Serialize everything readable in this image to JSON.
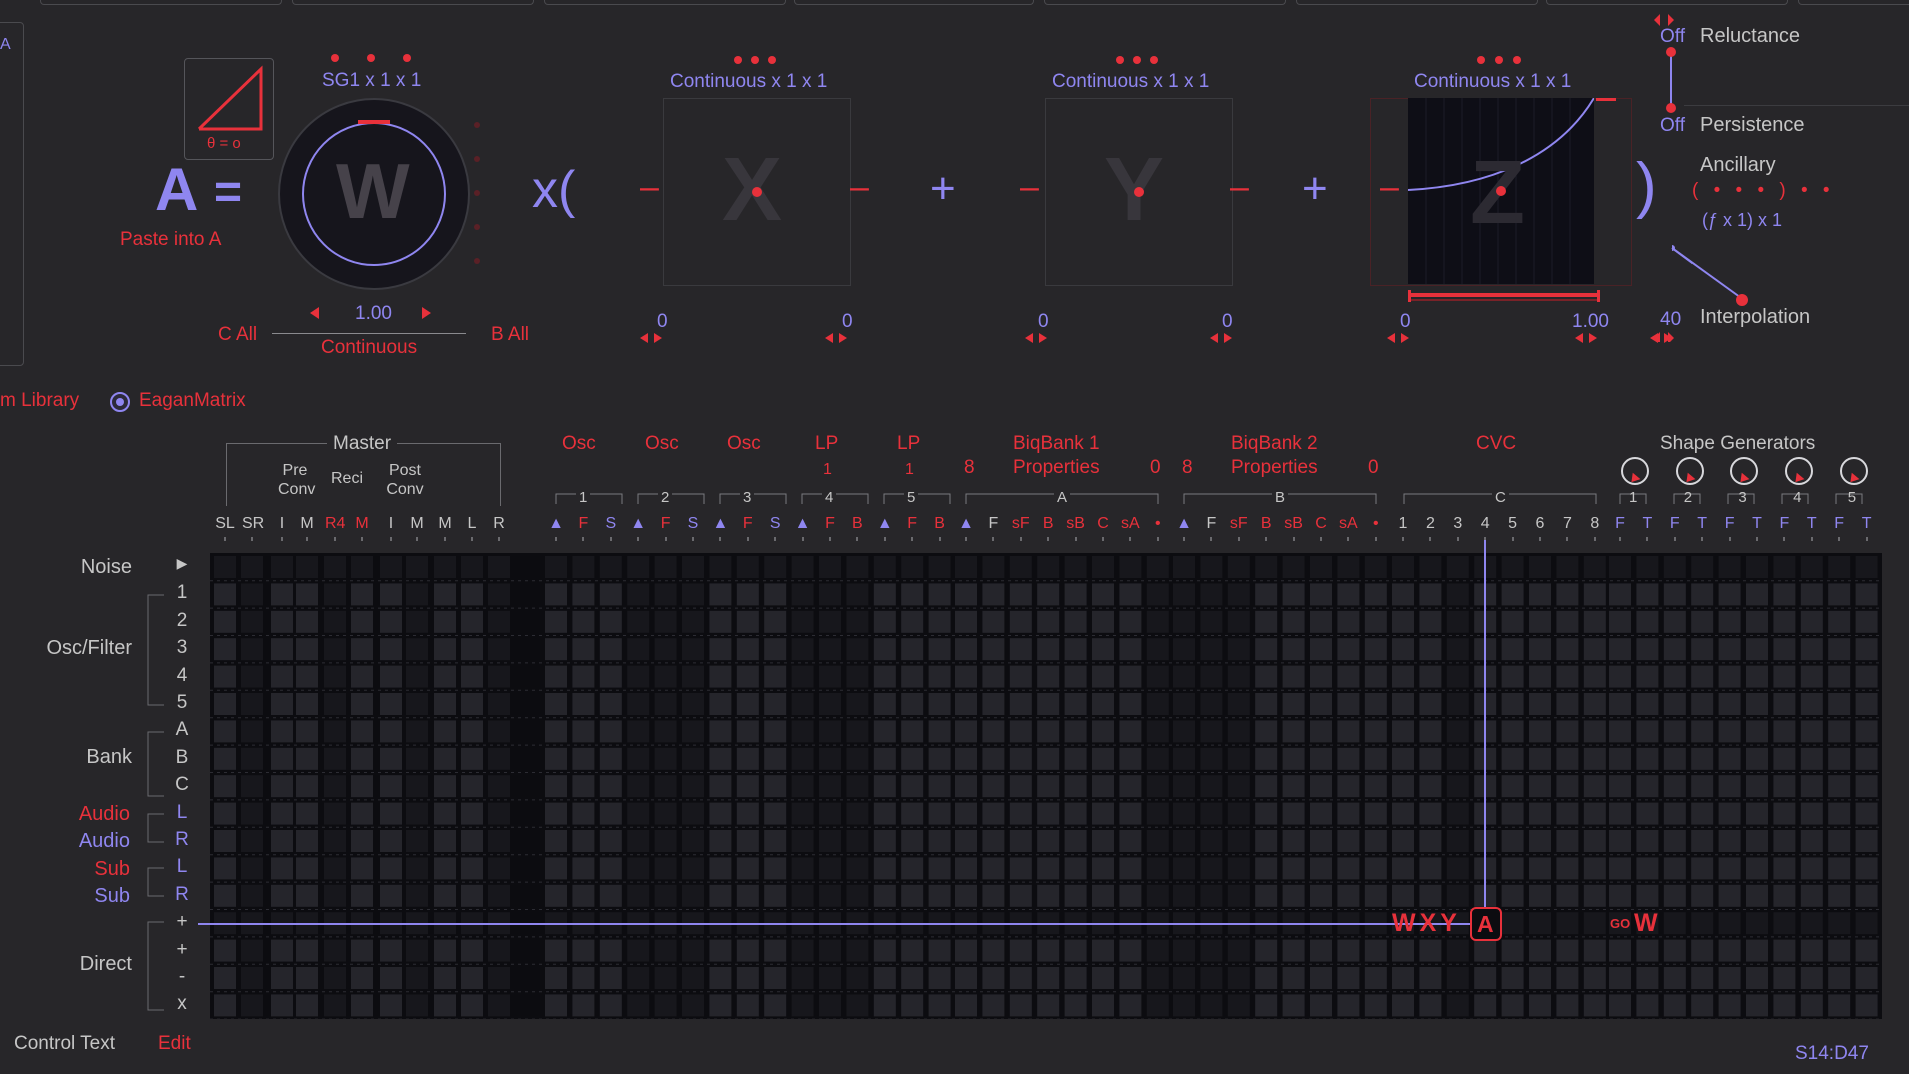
{
  "equation": {
    "lhs": "A",
    "equals": "=",
    "paste_label": "Paste into A",
    "ramp_caption": "θ = o",
    "w_header": "SG1 x 1 x 1",
    "w_letter": "W",
    "w_value": "1.00",
    "w_mode": "Continuous",
    "c_all": "C All",
    "b_all": "B All",
    "times_open": "x(",
    "close_paren": ")",
    "plus": "+",
    "minus": "–",
    "terms": [
      {
        "header": "Continuous x 1 x 1",
        "letter": "X",
        "left": "0",
        "right": "0"
      },
      {
        "header": "Continuous x 1 x 1",
        "letter": "Y",
        "left": "0",
        "right": "0"
      },
      {
        "header": "Continuous x 1 x 1",
        "letter": "Z",
        "left": "0",
        "right": "1.00"
      }
    ]
  },
  "side": {
    "reluctance_value": "Off",
    "reluctance_label": "Reluctance",
    "persistence_value": "Off",
    "persistence_label": "Persistence",
    "ancillary_label": "Ancillary",
    "ancillary_expr": "( • • • ) • •",
    "ancillary_sub": "(ƒ x 1) x 1",
    "interpolation_value": "40",
    "interpolation_label": "Interpolation"
  },
  "library": {
    "left_label": "m Library",
    "eagan_label": "EaganMatrix",
    "left_tab_letter": "A"
  },
  "matrix": {
    "master_label": "Master",
    "pre_conv": "Pre Conv",
    "reci": "Reci",
    "post_conv": "Post Conv",
    "group_labels": [
      {
        "text": "Osc",
        "sub": "1"
      },
      {
        "text": "Osc",
        "sub": "2"
      },
      {
        "text": "Osc",
        "sub": "3"
      },
      {
        "text": "LP",
        "sub": "4",
        "num": "1"
      },
      {
        "text": "LP",
        "sub": "5",
        "num": "1"
      }
    ],
    "biq1_title": "BiqBank 1",
    "biq1_props": "Properties",
    "biq1_left": "8",
    "biq1_right": "0",
    "biq1_letter": "A",
    "biq2_title": "BiqBank 2",
    "biq2_props": "Properties",
    "biq2_left": "8",
    "biq2_right": "0",
    "biq2_letter": "B",
    "cvc_title": "CVC",
    "cvc_letter": "C",
    "shape_title": "Shape Generators",
    "shape_nums": [
      "1",
      "2",
      "3",
      "4",
      "5"
    ],
    "columns_master": [
      "SL",
      "SR",
      "I",
      "M",
      "R4",
      "M",
      "I",
      "M",
      "M",
      "L",
      "R"
    ],
    "columns_osc": [
      "▲",
      "F",
      "S",
      "▲",
      "F",
      "S",
      "▲",
      "F",
      "S",
      "▲",
      "F",
      "B",
      "▲",
      "F",
      "B"
    ],
    "columns_biq1": [
      "▲",
      "F",
      "sF",
      "B",
      "sB",
      "C",
      "sA",
      "•"
    ],
    "columns_biq2": [
      "▲",
      "F",
      "sF",
      "B",
      "sB",
      "C",
      "sA",
      "•"
    ],
    "columns_cvc": [
      "1",
      "2",
      "3",
      "4",
      "5",
      "6",
      "7",
      "8"
    ],
    "columns_shape": [
      "F",
      "T",
      "F",
      "T",
      "F",
      "T",
      "F",
      "T",
      "F",
      "T"
    ],
    "row_groups": [
      "Noise",
      "Osc/Filter",
      "Bank",
      "Audio",
      "Audio",
      "Sub",
      "Sub",
      "Direct"
    ],
    "rows": [
      "▶",
      "1",
      "2",
      "3",
      "4",
      "5",
      "A",
      "B",
      "C",
      "L",
      "R",
      "L",
      "R",
      "+",
      "+",
      "-",
      "x"
    ],
    "wxya_label": "WXY",
    "a_box": "A",
    "go_label": "GO",
    "w_end": "W"
  },
  "footer": {
    "control_text": "Control Text",
    "edit": "Edit",
    "position": "S14:D47"
  },
  "colors": {
    "red": "#e8313b",
    "blue": "#8f86f0",
    "background": "#272629",
    "matrix_bg": "#0d0d12"
  }
}
